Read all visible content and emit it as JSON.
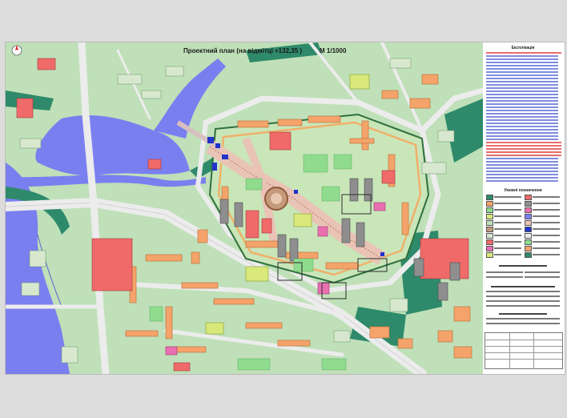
{
  "map": {
    "title": "Проектний план (на відмітці  +132,35 )",
    "scale": "М 1/1000",
    "colors": {
      "water": "#7a7ff0",
      "park_light": "#b9ddb3",
      "park_dark": "#2e8a6a",
      "road": "#ececec",
      "building_residential": "#f4a36a",
      "building_public": "#f06a6a",
      "building_pink": "#e96fb1",
      "building_gray": "#8e8e8e",
      "sports": "#d8e97a",
      "blue_marker": "#2233cc",
      "lawn": "#8fdc8f"
    }
  },
  "legend_panel": {
    "explication_title": "Експлікація",
    "conventions_title": "Умовні позначення"
  }
}
